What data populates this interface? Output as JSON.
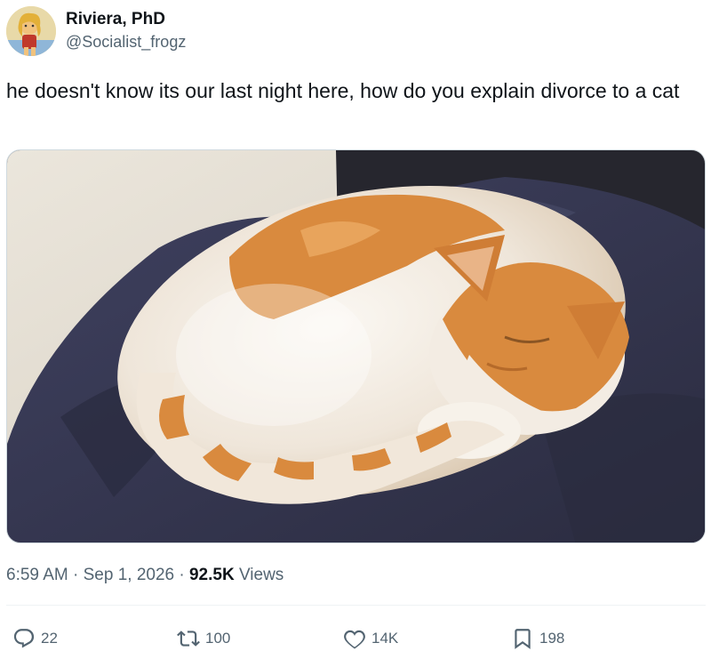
{
  "user": {
    "display_name": "Riviera, PhD",
    "handle": "@Socialist_frogz",
    "avatar_icon": "avatar-illustration"
  },
  "tweet": {
    "text": "he doesn't know its our last night here, how do you explain divorce to a cat",
    "media_alt": "orange-and-white cat curled up asleep on a dark blue blanket"
  },
  "meta": {
    "time": "6:59 AM",
    "separator": "·",
    "date": "Sep 1, 2026",
    "views_count": "92.5K",
    "views_label": "Views"
  },
  "actions": {
    "reply": {
      "icon": "reply-icon",
      "count": "22"
    },
    "retweet": {
      "icon": "retweet-icon",
      "count": "100"
    },
    "like": {
      "icon": "heart-icon",
      "count": "14K"
    },
    "bookmark": {
      "icon": "bookmark-icon",
      "count": "198"
    }
  },
  "colors": {
    "text_primary": "#0f1419",
    "text_secondary": "#536471",
    "blanket": "#33334a",
    "cat_orange": "#d98a3e",
    "cat_white": "#f4efe8"
  }
}
